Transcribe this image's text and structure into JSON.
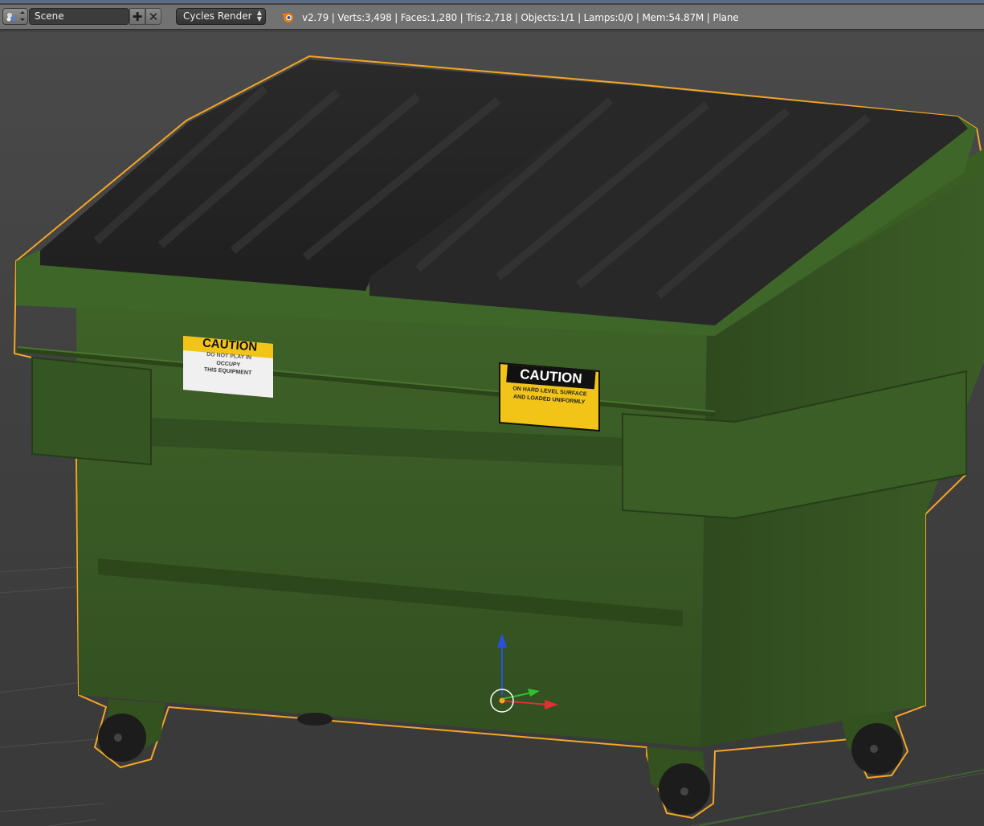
{
  "header": {
    "scene_name": "Scene",
    "render_engine": "Cycles Render",
    "stats": "v2.79 | Verts:3,498 | Faces:1,280 | Tris:2,718 | Objects:1/1 | Lamps:0/0 | Mem:54.87M | Plane",
    "icons": {
      "scene_selector": "scene-browse-icon",
      "add": "plus-icon",
      "close": "x-icon",
      "logo": "blender-logo-icon"
    }
  },
  "viewport": {
    "decals": {
      "left_title": "CAUTION",
      "left_line1": "DO NOT PLAY IN",
      "left_line2": "OCCUPY",
      "left_line3": "THIS EQUIPMENT",
      "right_title": "CAUTION",
      "right_line1": "ON HARD LEVEL SURFACE",
      "right_line2": "AND LOADED UNIFORMLY"
    },
    "colors": {
      "selection_outline": "#f5a623",
      "body_green": "#3a5a26",
      "lid_black": "#2a2a2a",
      "decal_yellow": "#f2c418",
      "axis_x": "#e03030",
      "axis_y": "#30c030",
      "axis_z": "#2a50e0"
    }
  }
}
